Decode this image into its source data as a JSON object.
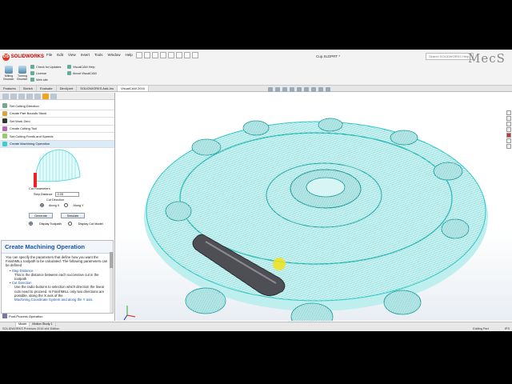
{
  "app": {
    "logo_text": "SOLIDWORKS",
    "doc_title": "Cup.SLDPRT *",
    "search_placeholder": "Search SOLIDWORKS Help"
  },
  "menu": [
    "File",
    "Edit",
    "View",
    "Insert",
    "Tools",
    "Window",
    "Help"
  ],
  "ribbon": {
    "buttons": [
      {
        "label": "Milling Browser"
      },
      {
        "label": "Turning Browser"
      }
    ],
    "links": [
      "Check for Updates",
      "License",
      "Web site",
      "VisualCAM Help",
      "About VisualCAM"
    ]
  },
  "tabs": [
    "Features",
    "Sketch",
    "Evaluate",
    "DimXpert",
    "SOLIDWORKS Add-Ins",
    "VisualCAM 2016"
  ],
  "panel": {
    "steps": [
      "Set Cutting Direction",
      "Create Part Bounds Stock",
      "Set Work Zero",
      "Create Cutting Tool",
      "Set Cutting Feeds and Speeds",
      "Create Machining Operation"
    ],
    "cut_parameters_label": "Cut Parameters",
    "step_distance_label": "Step Distance",
    "step_distance_value": "0.05",
    "cut_direction_label": "Cut Direction",
    "along_x": "Along X",
    "along_y": "Along Y",
    "generate": "Generate",
    "simulate": "Simulate",
    "display_toolpath": "Display Toolpath",
    "display_cut_model": "Display Cut Model",
    "post_process": "Post-Process Operation"
  },
  "help": {
    "title": "Create Machining Operation",
    "intro": "You can specify the parameters that define how you want the FinishMILL toolpath to be calculated. The following parameters can be defined",
    "items": [
      {
        "term": "Step Distance",
        "text": "This is the distance between each successive cut in the toolpath"
      },
      {
        "term": "Cut Direction",
        "text": "Use the radio buttons to selection which direction the linear cuts need to proceed. In FinishMILL only two directions are possible, along the X axis of the"
      }
    ],
    "more": "Machining Coordinate System and along the Y axis."
  },
  "watermark": "MecS",
  "status": {
    "tabs": [
      "Model",
      "Motion Study 1"
    ],
    "left": "SOLIDWORKS Premium 2016 x64 Edition",
    "mode": "Editing Part",
    "units": "IPS"
  },
  "colors": {
    "toolpath": "#3ed3d3",
    "toolpath_dark": "#1a8c8c",
    "accent": "#1a55a8",
    "cursor": "#f1e21a"
  }
}
